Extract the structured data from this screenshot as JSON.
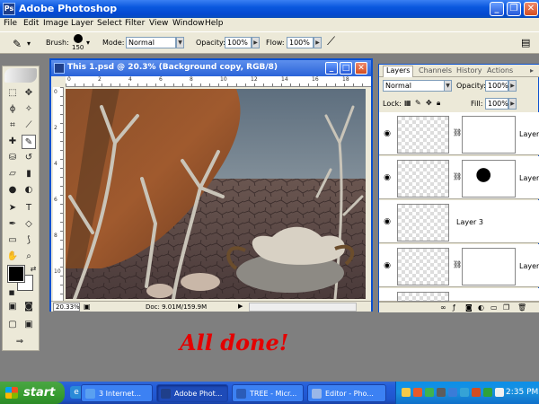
{
  "app": {
    "title": "Adobe Photoshop"
  },
  "menu": [
    "File",
    "Edit",
    "Image",
    "Layer",
    "Select",
    "Filter",
    "View",
    "Window",
    "Help"
  ],
  "options": {
    "brush_label": "Brush:",
    "brush_size": "150",
    "mode_label": "Mode:",
    "mode_value": "Normal",
    "opacity_label": "Opacity:",
    "opacity_value": "100%",
    "flow_label": "Flow:",
    "flow_value": "100%"
  },
  "document": {
    "title": "This 1.psd @ 20.3% (Background copy, RGB/8)",
    "zoom": "20.33%",
    "doc_info": "Doc: 9.01M/159.9M",
    "ruler_h": [
      "0",
      "2",
      "4",
      "6",
      "8",
      "10",
      "12",
      "14",
      "16",
      "18"
    ],
    "ruler_v": [
      "0",
      "2",
      "4",
      "6",
      "8",
      "10"
    ]
  },
  "layers_panel": {
    "tabs": [
      "Layers",
      "Channels",
      "History",
      "Actions"
    ],
    "blend_mode": "Normal",
    "opacity_label": "Opacity:",
    "opacity_value": "100%",
    "lock_label": "Lock:",
    "fill_label": "Fill:",
    "fill_value": "100%",
    "layers": [
      {
        "name": "Layer"
      },
      {
        "name": "Layer"
      },
      {
        "name": "Layer 3"
      },
      {
        "name": "Layer"
      }
    ]
  },
  "annotation": "All done!",
  "taskbar": {
    "start_label": "start",
    "tasks": [
      {
        "label": "3 Internet..."
      },
      {
        "label": "Adobe Phot..."
      },
      {
        "label": "TREE - Micr..."
      },
      {
        "label": "Editor - Pho..."
      }
    ],
    "clock": "2:35 PM"
  },
  "colors": {
    "accent_title": "#0a58de",
    "annotation": "#e40000",
    "start_button": "#379d30"
  }
}
